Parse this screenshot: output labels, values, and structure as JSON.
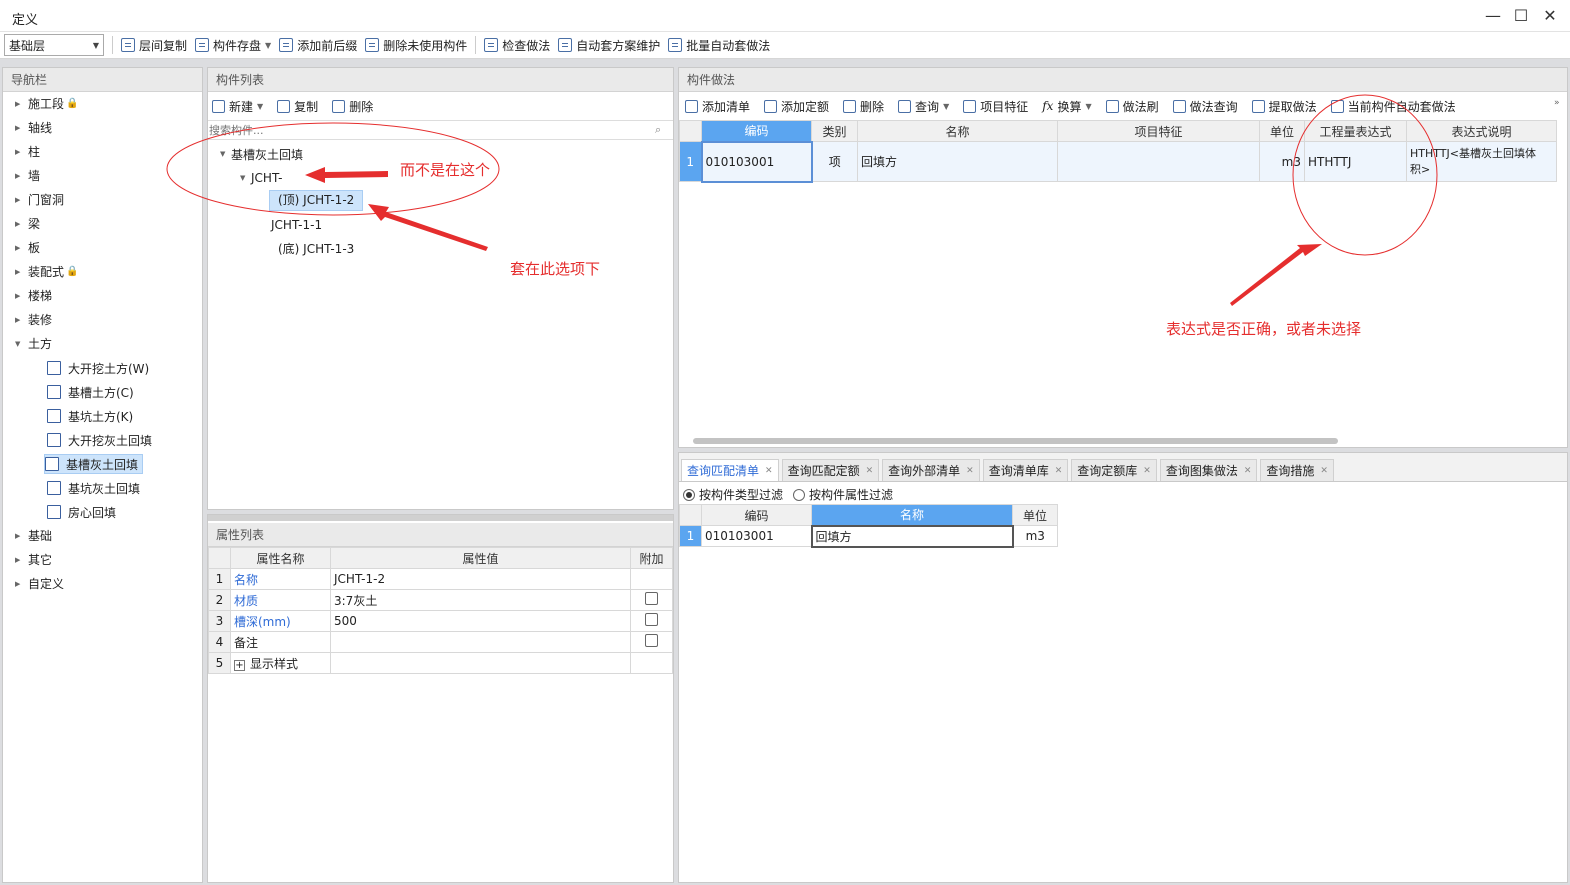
{
  "window": {
    "title": "定义",
    "minimize": "—",
    "maximize": "☐",
    "close": "✕"
  },
  "toolbar": {
    "floor_select": "基础层",
    "buttons": [
      "层间复制",
      "构件存盘",
      "添加前后缀",
      "删除未使用构件",
      "检查做法",
      "自动套方案维护",
      "批量自动套做法"
    ]
  },
  "nav": {
    "header": "导航栏",
    "items": [
      {
        "label": "施工段",
        "lock": true
      },
      {
        "label": "轴线"
      },
      {
        "label": "柱"
      },
      {
        "label": "墙"
      },
      {
        "label": "门窗洞"
      },
      {
        "label": "梁"
      },
      {
        "label": "板"
      },
      {
        "label": "装配式",
        "lock": true
      },
      {
        "label": "楼梯"
      },
      {
        "label": "装修"
      },
      {
        "label": "土方",
        "expanded": true
      }
    ],
    "sub": [
      "大开挖土方(W)",
      "基槽土方(C)",
      "基坑土方(K)",
      "大开挖灰土回填",
      "基槽灰土回填",
      "基坑灰土回填",
      "房心回填"
    ],
    "after": [
      "基础",
      "其它",
      "自定义"
    ]
  },
  "comp_list": {
    "header": "构件列表",
    "toolbar": [
      "新建",
      "复制",
      "删除"
    ],
    "search_placeholder": "搜索构件...",
    "tree": {
      "root": "基槽灰土回填",
      "group": "JCHT-",
      "items": [
        "(顶) JCHT-1-2",
        "JCHT-1-1",
        "(底) JCHT-1-3"
      ]
    }
  },
  "props": {
    "header": "属性列表",
    "columns": [
      "属性名称",
      "属性值",
      "附加"
    ],
    "rows": [
      {
        "n": "1",
        "name": "名称",
        "value": "JCHT-1-2",
        "check": false
      },
      {
        "n": "2",
        "name": "材质",
        "value": "3:7灰土",
        "check": true
      },
      {
        "n": "3",
        "name": "槽深(mm)",
        "value": "500",
        "check": true
      },
      {
        "n": "4",
        "name": "备注",
        "value": "",
        "check": true
      },
      {
        "n": "5",
        "name": "显示样式",
        "value": "",
        "check": false
      }
    ]
  },
  "method": {
    "header": "构件做法",
    "toolbar": [
      "添加清单",
      "添加定额",
      "删除",
      "查询",
      "项目特征",
      "换算",
      "做法刷",
      "做法查询",
      "提取做法",
      "当前构件自动套做法"
    ],
    "columns": [
      "编码",
      "类别",
      "名称",
      "项目特征",
      "单位",
      "工程量表达式",
      "表达式说明"
    ],
    "row": {
      "n": "1",
      "code": "010103001",
      "type": "项",
      "name": "回填方",
      "feature": "",
      "unit": "m3",
      "expr": "HTHTTJ",
      "desc_line1": "HTHTTJ<基槽灰土回填体",
      "desc_line2": "积>"
    }
  },
  "query": {
    "tabs": [
      "查询匹配清单",
      "查询匹配定额",
      "查询外部清单",
      "查询清单库",
      "查询定额库",
      "查询图集做法",
      "查询措施"
    ],
    "filters": [
      "按构件类型过滤",
      "按构件属性过滤"
    ],
    "columns": [
      "编码",
      "名称",
      "单位"
    ],
    "row": {
      "n": "1",
      "code": "010103001",
      "name": "回填方",
      "unit": "m3"
    }
  },
  "annotations": [
    "而不是在这个",
    "套在此选项下",
    "表达式是否正确，或者未选择"
  ],
  "colors": {
    "annotation": "#e52e2e",
    "selected": "#cde4fb",
    "header_blue": "#5ba5f0"
  }
}
